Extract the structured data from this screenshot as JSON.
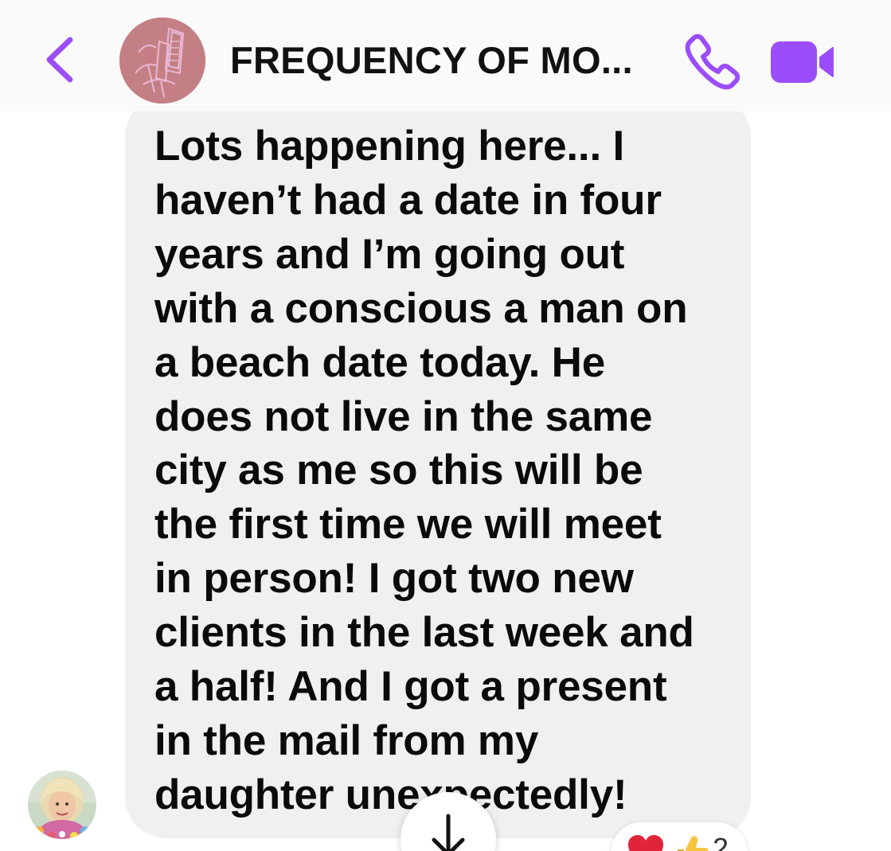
{
  "header": {
    "title": "FREQUENCY OF MO...",
    "back_icon": "chevron-left-icon",
    "call_icon": "phone-icon",
    "video_icon": "video-camera-icon"
  },
  "message": {
    "text": "Lots happening here... I\nhaven’t had a date in four\nyears and I’m going out\nwith a conscious a man on\na beach date today. He\ndoes not live in the same\ncity as me so this will be\nthe first time we will meet\nin person! I got two new\nclients in the last week and\na half! And I got a present\nin the mail from my\ndaughter unexpectedly!"
  },
  "scroll_button": {
    "icon": "arrow-down-icon"
  },
  "reactions": {
    "emojis": [
      "heart",
      "thumbs-up"
    ],
    "count": "2"
  },
  "colors": {
    "accent": "#9b4dfa",
    "bubble": "#f0f0f0",
    "text": "#0a0a0a",
    "header_bg": "#fafafa",
    "heart": "#e0243a",
    "thumb": "#f7c43f"
  }
}
